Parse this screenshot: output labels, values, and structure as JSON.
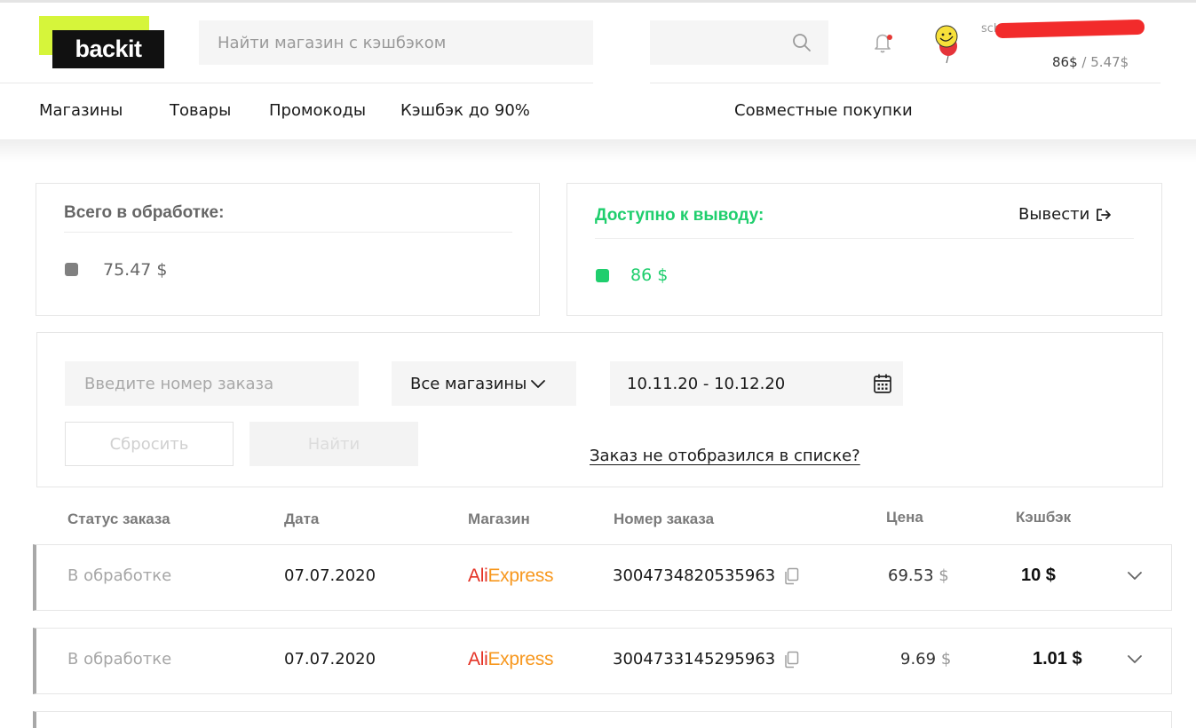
{
  "logo": {
    "text": "backit"
  },
  "search": {
    "placeholder": "Найти магазин с кэшбэком"
  },
  "user": {
    "name_visible": "sch",
    "balance_available": "86$",
    "balance_separator": "/",
    "balance_processing": "5.47$"
  },
  "nav": [
    "Магазины",
    "Товары",
    "Промокоды",
    "Кэшбэк до 90%",
    "Совместные покупки"
  ],
  "processing_card": {
    "title": "Всего в обработке:",
    "amount": "75.47 $"
  },
  "available_card": {
    "title": "Доступно к выводу:",
    "amount": "86 $",
    "withdraw_label": "Вывести"
  },
  "filters": {
    "order_placeholder": "Введите номер заказа",
    "shop_select": "Все магазины",
    "date_range": "10.11.20 - 10.12.20",
    "reset_label": "Сбросить",
    "find_label": "Найти",
    "missing_link": "Заказ не отобразился в списке?"
  },
  "table": {
    "headers": [
      "Статус заказа",
      "Дата",
      "Магазин",
      "Номер заказа",
      "Цена",
      "Кэшбэк"
    ],
    "rows": [
      {
        "status": "В обработке",
        "date": "07.07.2020",
        "shop_part1": "Ali",
        "shop_part2": "Express",
        "order": "3004734820535963",
        "price": "69.53",
        "price_currency": "$",
        "cashback": "10 $"
      },
      {
        "status": "В обработке",
        "date": "07.07.2020",
        "shop_part1": "Ali",
        "shop_part2": "Express",
        "order": "3004733145295963",
        "price": "9.69",
        "price_currency": "$",
        "cashback": "1.01 $"
      }
    ]
  },
  "colors": {
    "accent_lime": "#d6f53a",
    "green": "#1fce6d",
    "gray_square": "#808080",
    "redaction": "#f22b2b"
  },
  "icons": [
    "search-icon",
    "bell-icon",
    "avatar-balloon-icon",
    "withdraw-icon",
    "chevron-down-icon",
    "calendar-icon",
    "copy-icon"
  ]
}
